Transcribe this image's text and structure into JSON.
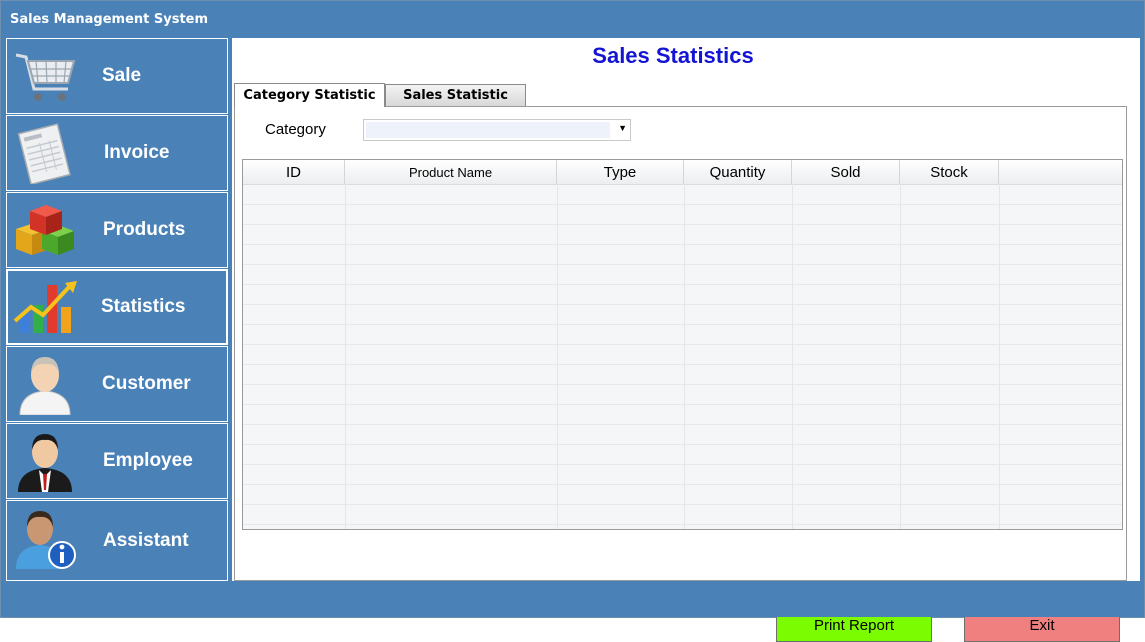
{
  "window": {
    "title": "Sales Management System"
  },
  "sidebar": {
    "items": [
      {
        "label": "Sale",
        "icon": "shopping-cart-icon"
      },
      {
        "label": "Invoice",
        "icon": "invoice-icon"
      },
      {
        "label": "Products",
        "icon": "products-boxes-icon"
      },
      {
        "label": "Statistics",
        "icon": "statistics-chart-icon",
        "active": true
      },
      {
        "label": "Customer",
        "icon": "customer-icon"
      },
      {
        "label": "Employee",
        "icon": "employee-icon"
      },
      {
        "label": "Assistant",
        "icon": "assistant-info-icon"
      }
    ]
  },
  "main": {
    "title": "Sales Statistics",
    "tabs": [
      {
        "label": "Category Statistic",
        "active": true
      },
      {
        "label": "Sales Statistic",
        "active": false
      }
    ],
    "filter": {
      "label": "Category",
      "value": ""
    },
    "table": {
      "columns": [
        "ID",
        "Product Name",
        "Type",
        "Quantity",
        "Sold",
        "Stock"
      ],
      "rows": []
    },
    "buttons": {
      "print": "Print Report",
      "exit": "Exit"
    }
  },
  "colors": {
    "background": "#4a82b8",
    "title": "#1414d4",
    "print_button": "#7cfc00",
    "exit_button": "#f08080"
  }
}
